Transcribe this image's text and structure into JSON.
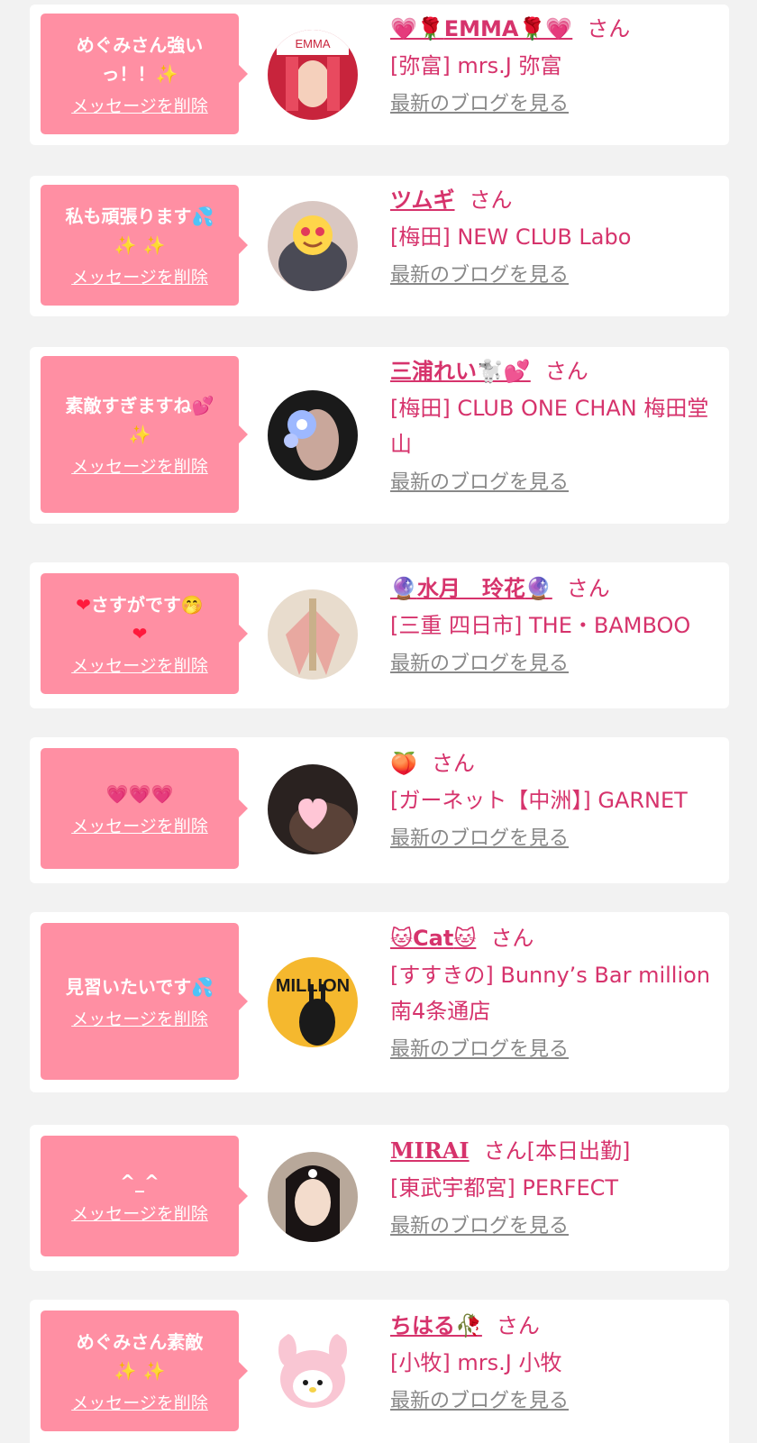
{
  "delete_label": "メッセージを削除",
  "blog_label": "最新のブログを見る",
  "cards": [
    {
      "msg": [
        "めぐみさん強い",
        "っ！！"
      ],
      "msg_suffix": "✨",
      "name_pre": "💗🌹",
      "name": "EMMA",
      "name_post": "🌹💗",
      "san": "さん",
      "shop": "[弥富] mrs.J 弥富"
    },
    {
      "msg": [
        "私も頑張ります"
      ],
      "msg_suffix": "💦",
      "msg_line2": "✨ ✨",
      "name_pre": "",
      "name": "ツムギ",
      "name_post": "",
      "san": "さん",
      "shop": "[梅田] NEW CLUB Labo"
    },
    {
      "msg": [
        "素敵すぎますね"
      ],
      "msg_suffix": "💕",
      "msg_line2": "✨",
      "name_pre": "",
      "name": "三浦れい",
      "name_post": "🐩💕",
      "san": "さん",
      "shop": "[梅田] CLUB ONE CHAN 梅田堂山"
    },
    {
      "msg": [
        "さすがです"
      ],
      "msg_prefix": "❤",
      "msg_suffix": "🤭",
      "msg_line2": "❤",
      "name_pre": "🔮",
      "name": "水月　玲花",
      "name_post": "🔮",
      "san": "さん",
      "shop": "[三重 四日市] THE・BAMBOO"
    },
    {
      "msg": [],
      "msg_line2": "💗💗💗",
      "name_pre": "🍑",
      "name": "",
      "name_post": "",
      "san": "さん",
      "shop": "[ガーネット【中洲】] GARNET"
    },
    {
      "msg": [
        "見習いたいです"
      ],
      "msg_suffix": "💦",
      "name_pre": "🐱",
      "name": "Cat",
      "name_post": "🐱",
      "san": "さん",
      "shop": "[すすきの] Bunny’s Bar million 南4条通店"
    },
    {
      "msg": [
        "^_^"
      ],
      "name_pre": "",
      "name": "MIRAI",
      "name_post": "",
      "san": "さん[本日出勤]",
      "shop": "[東武宇都宮] PERFECT"
    },
    {
      "msg": [
        "めぐみさん素敵"
      ],
      "msg_line2": "✨ ✨",
      "name_pre": "",
      "name": "ちはる",
      "name_post": "🥀",
      "san": "さん",
      "shop": "[小牧] mrs.J 小牧"
    }
  ],
  "colors": {
    "bubble": "#ff8fa3",
    "accent": "#d6336c",
    "link_gray": "#888888",
    "bg": "#f2f2f2"
  },
  "avatars": [
    "avatar-photo-emma",
    "avatar-photo-tsumugi",
    "avatar-photo-miura-rei",
    "avatar-photo-mizuki-reika",
    "avatar-photo-peach",
    "avatar-photo-cat",
    "avatar-photo-mirai",
    "avatar-plush-my-melody"
  ]
}
